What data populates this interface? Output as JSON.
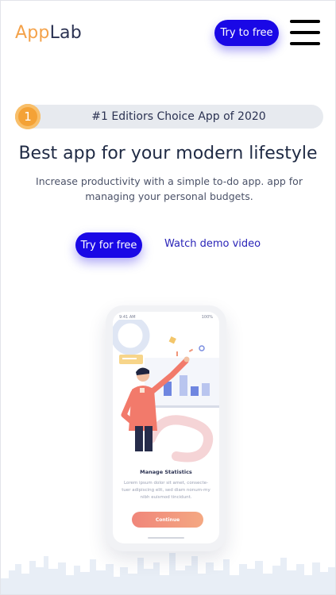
{
  "header": {
    "logo_part1": "App",
    "logo_part2": "Lab",
    "cta_label": "Try to free",
    "menu_icon": "hamburger-icon"
  },
  "badge": {
    "number": "1",
    "text": "#1 Editiors Choice App of 2020"
  },
  "hero": {
    "title": "Best app for your modern lifestyle",
    "subtitle": "Increase productivity with a simple to-do app. app for managing your personal budgets.",
    "primary_button": "Try for free",
    "secondary_link": "Watch demo video"
  },
  "phone_mockup": {
    "status_time": "9:41 AM",
    "status_right": "100%",
    "card_title": "Manage Statistics",
    "card_text": "Lorem ipsum dolor sit amet, consecte-tuer adipiscing elit, sed diam nonum-my nibh euismod tincidunt.",
    "continue_label": "Continue"
  },
  "colors": {
    "primary": "#1a08e6",
    "logo_accent": "#f4a24a",
    "badge_bg": "#e7eaef",
    "badge_number": "#f4a236",
    "continue_gradient_start": "#f0867a"
  }
}
